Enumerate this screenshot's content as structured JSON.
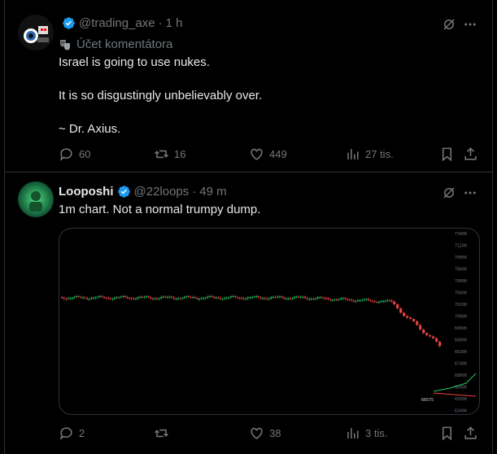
{
  "posts": [
    {
      "handle": "@trading_axe",
      "time": "1 h",
      "community_note": "Účet komentátora",
      "lines": [
        "Israel is going to use nukes.",
        "It is so disgustingly unbelievably over.",
        "~ Dr. Axius."
      ],
      "stats": {
        "replies": "60",
        "reposts": "16",
        "likes": "449",
        "views": "27 tis."
      }
    },
    {
      "name": "Looposhi",
      "handle": "@22loops",
      "time": "49 m",
      "text": "1m chart. Not a normal trumpy dump.",
      "stats": {
        "replies": "2",
        "reposts": "",
        "likes": "38",
        "views": "3 tis."
      },
      "chart": {
        "price_ticks": [
          "73400",
          "71200",
          "70000",
          "78600",
          "78000",
          "76600",
          "78100",
          "70000",
          "69600",
          "68000",
          "68200",
          "67400",
          "68600",
          "66000",
          "65600",
          "63400",
          "62600",
          "62000"
        ],
        "last_label": "66575"
      }
    }
  ],
  "colors": {
    "bg": "#000000",
    "text": "#e7e9ea",
    "muted": "#71767b",
    "border": "#2f3336",
    "verified": "#1d9bf0",
    "candle_up": "#22c55e",
    "candle_down": "#ef4444"
  }
}
